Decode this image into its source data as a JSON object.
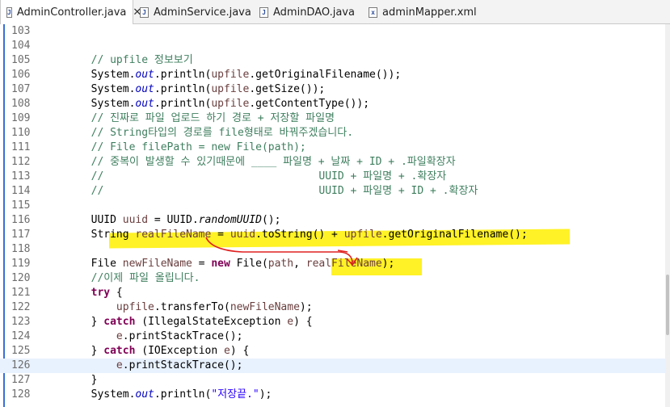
{
  "tabs": [
    {
      "label": "AdminController.java",
      "icon": "java-file-icon",
      "active": true,
      "close": "✕"
    },
    {
      "label": "AdminService.java",
      "icon": "java-file-icon",
      "active": false
    },
    {
      "label": "AdminDAO.java",
      "icon": "java-file-icon",
      "active": false
    },
    {
      "label": "adminMapper.xml",
      "icon": "xml-file-icon",
      "active": false
    }
  ],
  "lines": [
    {
      "n": "103",
      "segs": []
    },
    {
      "n": "104",
      "segs": []
    },
    {
      "n": "105",
      "segs": [
        [
          "p",
          "        "
        ],
        [
          "cm",
          "// upfile 정보보기"
        ]
      ]
    },
    {
      "n": "106",
      "segs": [
        [
          "p",
          "        System."
        ],
        [
          "fld",
          "out"
        ],
        [
          "p",
          ".println("
        ],
        [
          "var",
          "upfile"
        ],
        [
          "p",
          ".getOriginalFilename());"
        ]
      ]
    },
    {
      "n": "107",
      "segs": [
        [
          "p",
          "        System."
        ],
        [
          "fld",
          "out"
        ],
        [
          "p",
          ".println("
        ],
        [
          "var",
          "upfile"
        ],
        [
          "p",
          ".getSize());"
        ]
      ]
    },
    {
      "n": "108",
      "segs": [
        [
          "p",
          "        System."
        ],
        [
          "fld",
          "out"
        ],
        [
          "p",
          ".println("
        ],
        [
          "var",
          "upfile"
        ],
        [
          "p",
          ".getContentType());"
        ]
      ]
    },
    {
      "n": "109",
      "segs": [
        [
          "p",
          "        "
        ],
        [
          "cm",
          "// 진짜로 파일 업로드 하기 경로 + 저장할 파일명"
        ]
      ]
    },
    {
      "n": "110",
      "segs": [
        [
          "p",
          "        "
        ],
        [
          "cm",
          "// String타입의 경로를 file형태로 바꿔주겠습니다."
        ]
      ]
    },
    {
      "n": "111",
      "segs": [
        [
          "p",
          "        "
        ],
        [
          "cm",
          "// File filePath = new File(path);"
        ]
      ]
    },
    {
      "n": "112",
      "segs": [
        [
          "p",
          "        "
        ],
        [
          "cm",
          "// 중복이 발생할 수 있기때문에 ____ 파일명 + 날짜 + ID + .파일확장자"
        ]
      ]
    },
    {
      "n": "113",
      "segs": [
        [
          "p",
          "        "
        ],
        [
          "cm",
          "//                                  UUID + 파일명 + .확장자"
        ]
      ]
    },
    {
      "n": "114",
      "segs": [
        [
          "p",
          "        "
        ],
        [
          "cm",
          "//                                  UUID + 파일명 + ID + .확장자"
        ]
      ]
    },
    {
      "n": "115",
      "segs": []
    },
    {
      "n": "116",
      "segs": [
        [
          "p",
          "        UUID "
        ],
        [
          "var",
          "uuid"
        ],
        [
          "p",
          " = UUID."
        ],
        [
          "mth",
          "randomUUID"
        ],
        [
          "p",
          "();"
        ]
      ]
    },
    {
      "n": "117",
      "segs": [
        [
          "p",
          "        String "
        ],
        [
          "var",
          "realFileName"
        ],
        [
          "p",
          " = "
        ],
        [
          "var",
          "uuid"
        ],
        [
          "p",
          ".toString() + "
        ],
        [
          "var",
          "upfile"
        ],
        [
          "p",
          ".getOriginalFilename();"
        ]
      ]
    },
    {
      "n": "118",
      "segs": []
    },
    {
      "n": "119",
      "segs": [
        [
          "p",
          "        File "
        ],
        [
          "var",
          "newFileName"
        ],
        [
          "p",
          " = "
        ],
        [
          "kw",
          "new"
        ],
        [
          "p",
          " File("
        ],
        [
          "var",
          "path"
        ],
        [
          "p",
          ", "
        ],
        [
          "var",
          "realFileName"
        ],
        [
          "p",
          ");"
        ]
      ]
    },
    {
      "n": "120",
      "segs": [
        [
          "p",
          "        "
        ],
        [
          "cm",
          "//이제 파일 올립니다."
        ]
      ]
    },
    {
      "n": "121",
      "segs": [
        [
          "p",
          "        "
        ],
        [
          "kw",
          "try"
        ],
        [
          "p",
          " {"
        ]
      ]
    },
    {
      "n": "122",
      "segs": [
        [
          "p",
          "            "
        ],
        [
          "var",
          "upfile"
        ],
        [
          "p",
          ".transferTo("
        ],
        [
          "var",
          "newFileName"
        ],
        [
          "p",
          ");"
        ]
      ]
    },
    {
      "n": "123",
      "segs": [
        [
          "p",
          "        } "
        ],
        [
          "kw",
          "catch"
        ],
        [
          "p",
          " (IllegalStateException "
        ],
        [
          "var",
          "e"
        ],
        [
          "p",
          ") {"
        ]
      ]
    },
    {
      "n": "124",
      "segs": [
        [
          "p",
          "            "
        ],
        [
          "var",
          "e"
        ],
        [
          "p",
          ".printStackTrace();"
        ]
      ]
    },
    {
      "n": "125",
      "segs": [
        [
          "p",
          "        } "
        ],
        [
          "kw",
          "catch"
        ],
        [
          "p",
          " (IOException "
        ],
        [
          "var",
          "e"
        ],
        [
          "p",
          ") {"
        ]
      ]
    },
    {
      "n": "126",
      "segs": [
        [
          "p",
          "            "
        ],
        [
          "var",
          "e"
        ],
        [
          "p",
          ".printStackTrace();"
        ]
      ],
      "current": true
    },
    {
      "n": "127",
      "segs": [
        [
          "p",
          "        }"
        ]
      ]
    },
    {
      "n": "128",
      "segs": [
        [
          "p",
          "        System."
        ],
        [
          "fld",
          "out"
        ],
        [
          "p",
          ".println("
        ],
        [
          "str",
          "\"저장끝.\""
        ],
        [
          "p",
          ");"
        ]
      ]
    }
  ],
  "colors": {
    "comment": "#3f7f5f",
    "keyword": "#7f0055",
    "field": "#0000c0",
    "variable": "#6a3e3e",
    "string": "#2a00ff",
    "highlighter": "#fff000",
    "annotation_arrow": "#e02020",
    "current_line": "#e8f2fe"
  }
}
